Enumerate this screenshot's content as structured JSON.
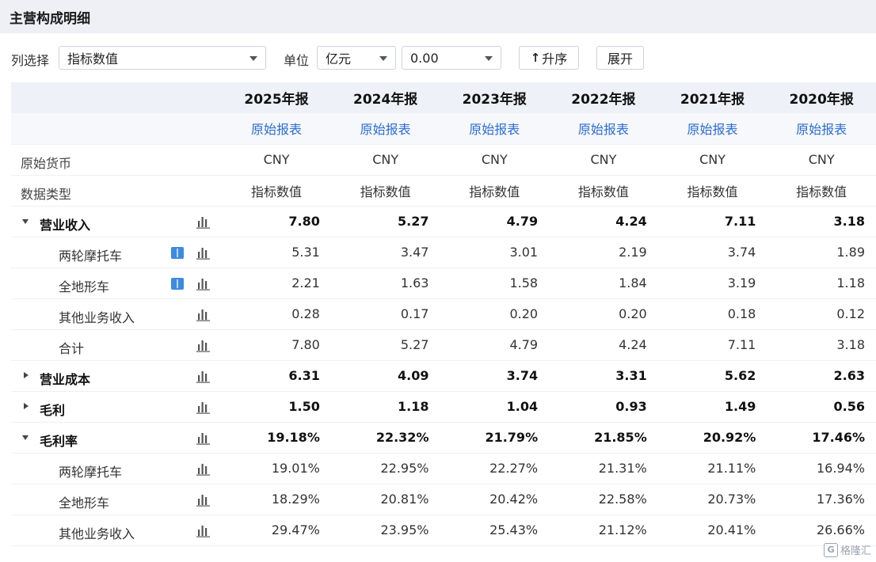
{
  "title": "主营构成明细",
  "toolbar": {
    "column_select_label": "列选择",
    "column_select_value": "指标数值",
    "unit_label": "单位",
    "unit_value": "亿元",
    "precision_value": "0.00",
    "sort_button_label": "升序",
    "sort_icon": "up-arrow-icon",
    "expand_button_label": "展开"
  },
  "years": [
    "2025年报",
    "2024年报",
    "2023年报",
    "2022年报",
    "2021年报",
    "2020年报"
  ],
  "report_link_label": "原始报表",
  "meta_rows": [
    {
      "label": "原始货币",
      "values": [
        "CNY",
        "CNY",
        "CNY",
        "CNY",
        "CNY",
        "CNY"
      ]
    },
    {
      "label": "数据类型",
      "values": [
        "指标数值",
        "指标数值",
        "指标数值",
        "指标数值",
        "指标数值",
        "指标数值"
      ]
    }
  ],
  "rows": [
    {
      "label": "营业收入",
      "values": [
        "7.80",
        "5.27",
        "4.79",
        "4.24",
        "7.11",
        "3.18"
      ]
    },
    {
      "label": "两轮摩托车",
      "values": [
        "5.31",
        "3.47",
        "3.01",
        "2.19",
        "3.74",
        "1.89"
      ]
    },
    {
      "label": "全地形车",
      "values": [
        "2.21",
        "1.63",
        "1.58",
        "1.84",
        "3.19",
        "1.18"
      ]
    },
    {
      "label": "其他业务收入",
      "values": [
        "0.28",
        "0.17",
        "0.20",
        "0.20",
        "0.18",
        "0.12"
      ]
    },
    {
      "label": "合计",
      "values": [
        "7.80",
        "5.27",
        "4.79",
        "4.24",
        "7.11",
        "3.18"
      ]
    },
    {
      "label": "营业成本",
      "values": [
        "6.31",
        "4.09",
        "3.74",
        "3.31",
        "5.62",
        "2.63"
      ]
    },
    {
      "label": "毛利",
      "values": [
        "1.50",
        "1.18",
        "1.04",
        "0.93",
        "1.49",
        "0.56"
      ]
    },
    {
      "label": "毛利率",
      "values": [
        "19.18%",
        "22.32%",
        "21.79%",
        "21.85%",
        "20.92%",
        "17.46%"
      ]
    },
    {
      "label": "两轮摩托车",
      "values": [
        "19.01%",
        "22.95%",
        "22.27%",
        "21.31%",
        "21.11%",
        "16.94%"
      ]
    },
    {
      "label": "全地形车",
      "values": [
        "18.29%",
        "20.81%",
        "20.42%",
        "22.58%",
        "20.73%",
        "17.36%"
      ]
    },
    {
      "label": "其他业务收入",
      "values": [
        "29.47%",
        "23.95%",
        "25.43%",
        "21.12%",
        "20.41%",
        "26.66%"
      ]
    }
  ],
  "watermark_text": "格隆汇",
  "watermark_logo_letter": "G",
  "colors": {
    "link": "#2b6cd6",
    "header_bg": "#eef1f7",
    "title_bg": "#eef0f5",
    "book_icon": "#3d8be0"
  }
}
